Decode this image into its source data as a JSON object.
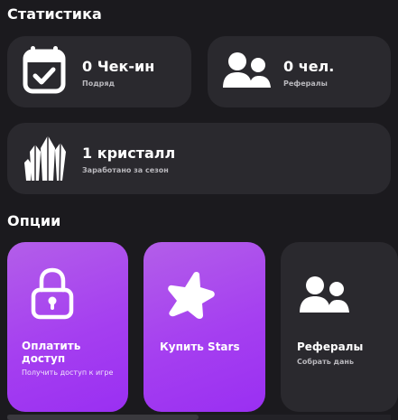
{
  "colors": {
    "background": "#1b1a1e",
    "card": "#2a292e",
    "accent_purple": "#a53ff0",
    "muted_text": "#b9b8bd"
  },
  "statistics": {
    "title": "Статистика",
    "checkin": {
      "icon": "calendar-check-icon",
      "value": "0 Чек-ин",
      "label": "Подряд"
    },
    "referrals": {
      "icon": "users-icon",
      "value": "0 чел.",
      "label": "Рефералы"
    },
    "crystals": {
      "icon": "crystals-icon",
      "value": "1 кристалл",
      "label": "Заработано за сезон"
    }
  },
  "options": {
    "title": "Опции",
    "items": [
      {
        "icon": "lock-icon",
        "title": "Оплатить доступ",
        "subtitle": "Получить доступ к игре"
      },
      {
        "icon": "star-icon",
        "title": "Купить Stars",
        "subtitle": ""
      },
      {
        "icon": "users-icon",
        "title": "Рефералы",
        "subtitle": "Собрать дань"
      }
    ]
  }
}
